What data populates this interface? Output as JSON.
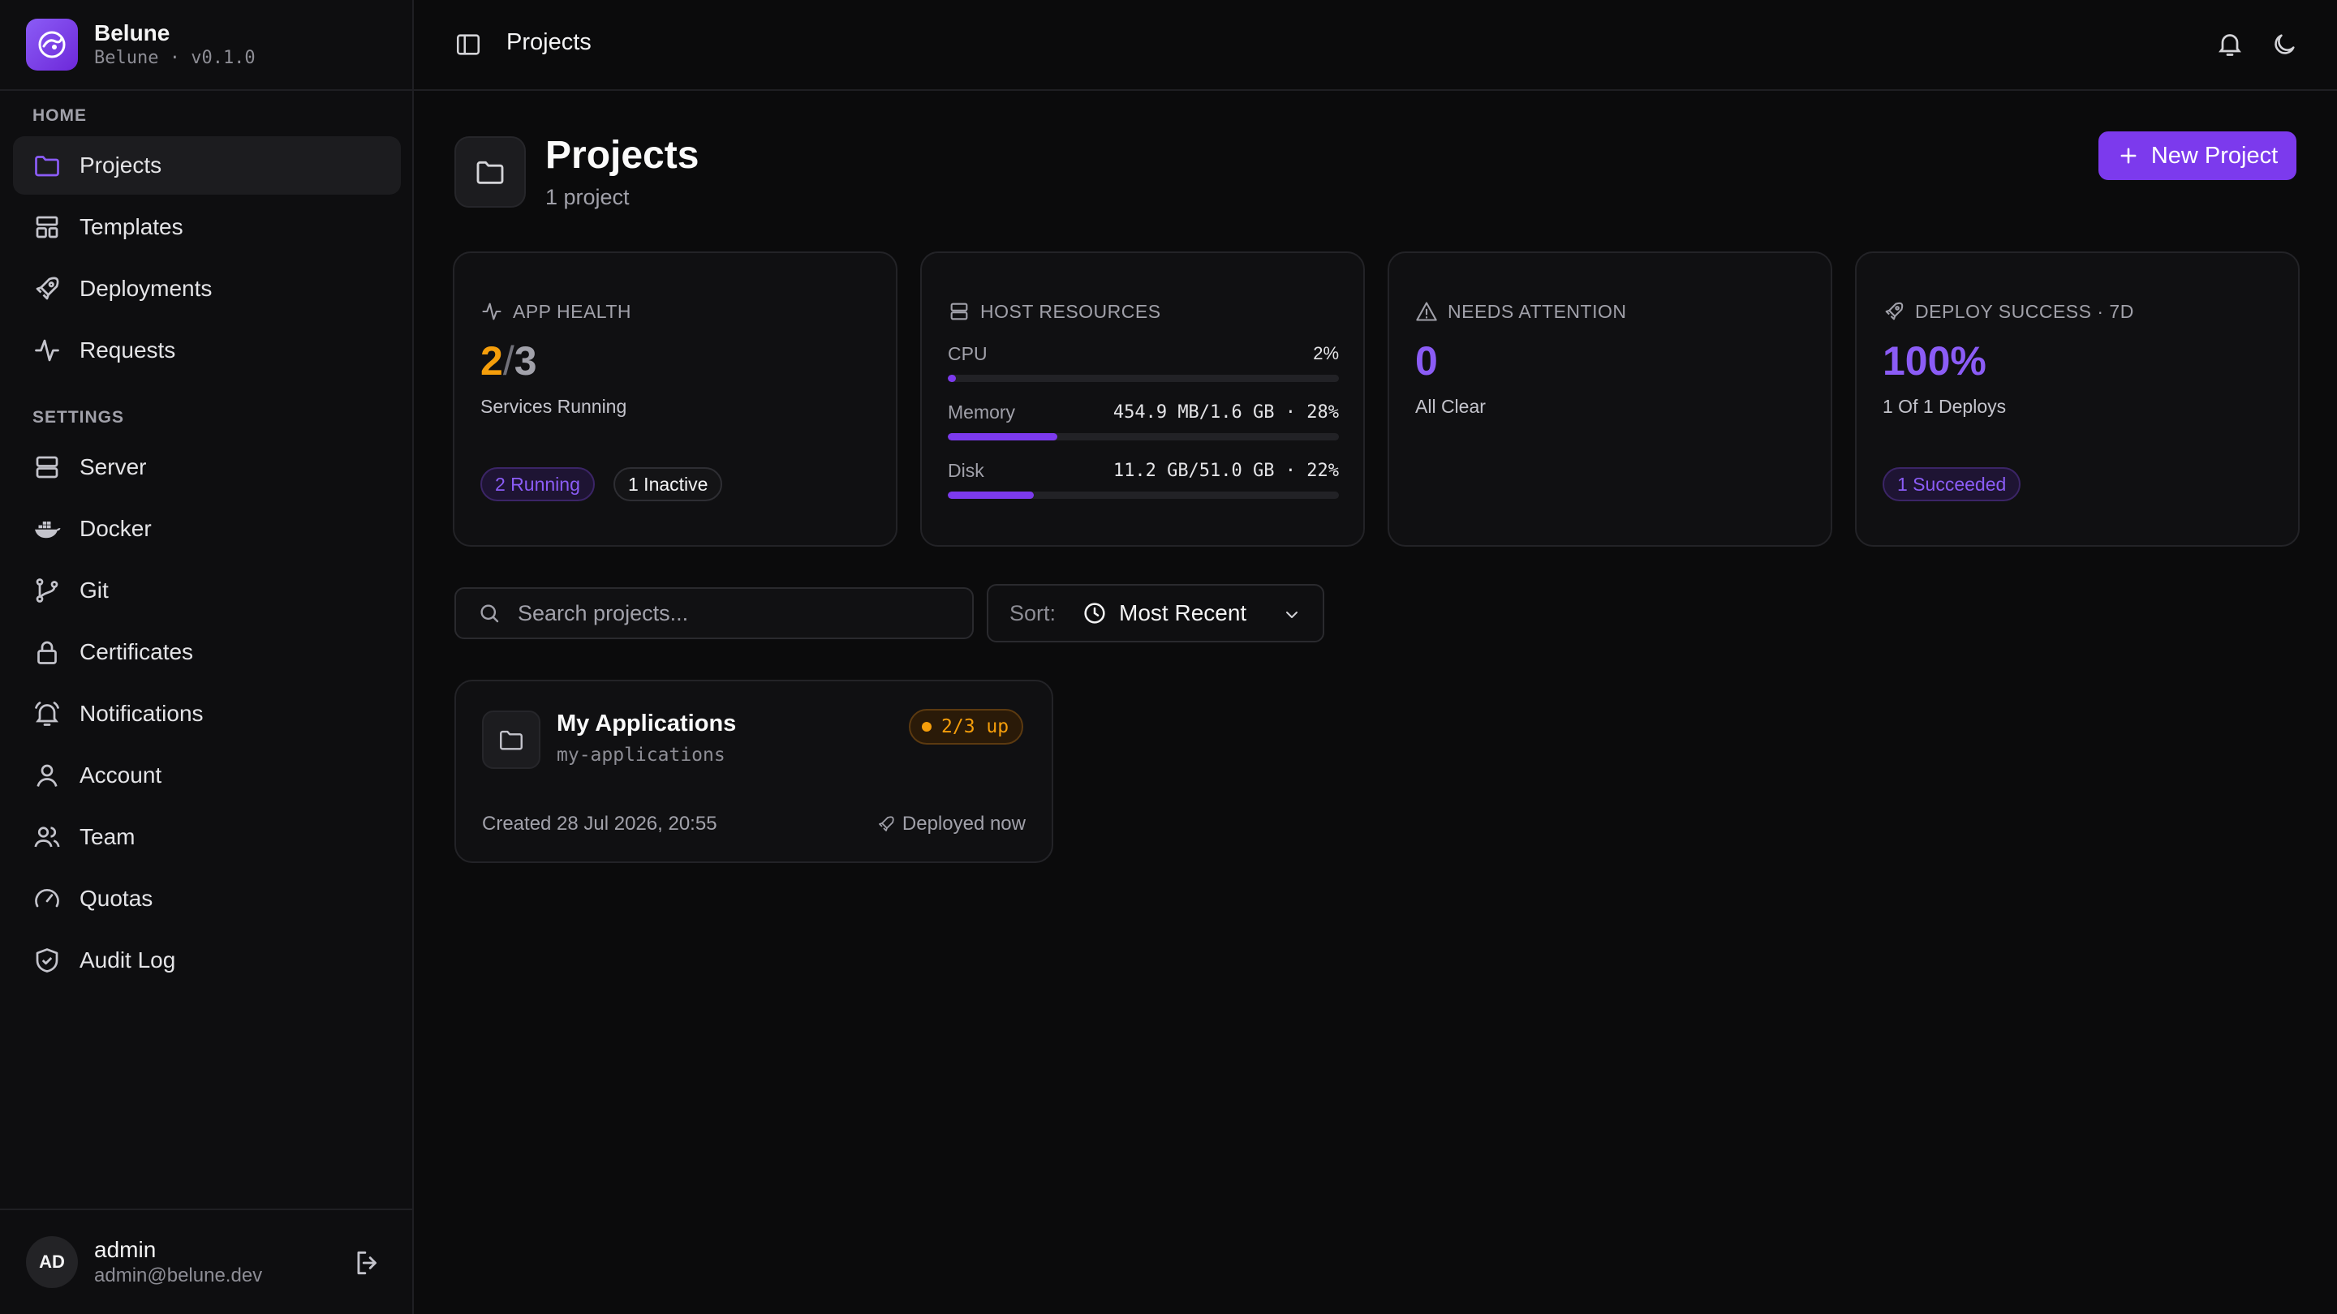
{
  "brand": {
    "name": "Belune",
    "subtitle": "Belune · v0.1.0"
  },
  "sidebar": {
    "home_label": "HOME",
    "settings_label": "SETTINGS",
    "home_items": [
      {
        "label": "Projects",
        "icon": "folder-icon",
        "active": true
      },
      {
        "label": "Templates",
        "icon": "layout-icon"
      },
      {
        "label": "Deployments",
        "icon": "rocket-icon"
      },
      {
        "label": "Requests",
        "icon": "activity-icon"
      }
    ],
    "settings_items": [
      {
        "label": "Server",
        "icon": "server-icon"
      },
      {
        "label": "Docker",
        "icon": "docker-icon"
      },
      {
        "label": "Git",
        "icon": "git-branch-icon"
      },
      {
        "label": "Certificates",
        "icon": "lock-icon"
      },
      {
        "label": "Notifications",
        "icon": "bell-ring-icon"
      },
      {
        "label": "Account",
        "icon": "user-icon"
      },
      {
        "label": "Team",
        "icon": "users-icon"
      },
      {
        "label": "Quotas",
        "icon": "gauge-icon"
      },
      {
        "label": "Audit Log",
        "icon": "shield-check-icon"
      }
    ]
  },
  "user": {
    "initials": "AD",
    "name": "admin",
    "email": "admin@belune.dev"
  },
  "topbar": {
    "title": "Projects"
  },
  "header": {
    "title": "Projects",
    "subtitle": "1 project",
    "new_button": "New Project"
  },
  "stats": {
    "app_health": {
      "label": "APP HEALTH",
      "running": "2",
      "separator": "/",
      "total": "3",
      "sub": "Services Running",
      "pill_running": "2 Running",
      "pill_inactive": "1 Inactive"
    },
    "host_resources": {
      "label": "HOST RESOURCES",
      "cpu": {
        "label": "CPU",
        "value": "2%",
        "percent": 2
      },
      "memory": {
        "label": "Memory",
        "value": "454.9 MB/1.6 GB · 28%",
        "percent": 28
      },
      "disk": {
        "label": "Disk",
        "value": "11.2 GB/51.0 GB · 22%",
        "percent": 22
      }
    },
    "needs_attention": {
      "label": "NEEDS ATTENTION",
      "value": "0",
      "sub": "All Clear"
    },
    "deploy_success": {
      "label": "DEPLOY SUCCESS · 7D",
      "value": "100%",
      "sub": "1 Of 1 Deploys",
      "pill": "1 Succeeded"
    }
  },
  "search": {
    "placeholder": "Search projects..."
  },
  "sort": {
    "label": "Sort:",
    "value": "Most Recent"
  },
  "project": {
    "name": "My Applications",
    "slug": "my-applications",
    "status": "2/3 up",
    "created": "Created 28 Jul 2026, 20:55",
    "deployed": "Deployed now"
  },
  "colors": {
    "accent": "#7c3aed",
    "warning": "#f59e0b",
    "background": "#0b0b0c"
  }
}
